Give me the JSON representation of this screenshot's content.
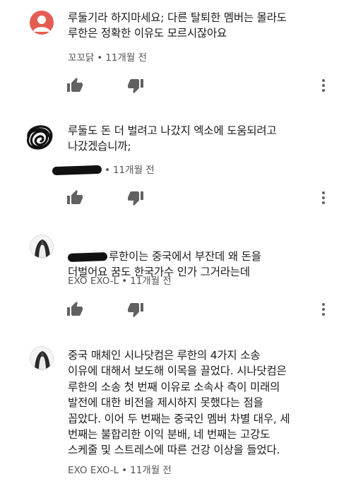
{
  "comments": [
    {
      "author": "꼬꼬닭",
      "text": "루둘기라 하지마세요; 다른 탈퇴한 멤버는 몰라도\n루한은 정확한 이유도 모르시잖아요",
      "time": "11개월 전",
      "avatar": "person-placeholder"
    },
    {
      "author": "",
      "text": "루둘도 돈 더 벌려고 나갔지 엑소에 도움되려고\n나갔겠습니까;",
      "time": "11개월 전",
      "avatar": "scribbled-out"
    },
    {
      "author": "EXO EXO-L",
      "text": "루한이는 중국에서 부잔데 왜 돈을\n더벌어요 꿈도 한국가수 인가 그거라는데",
      "time": "11개월 전",
      "avatar": "exo-photo"
    },
    {
      "author": "EXO EXO-L",
      "text": "중국 매체인 시나닷컴은 루한의 4가지 소송\n이유에 대해서 보도해 이목을 끌었다. 시나닷컴은\n루한의 소송 첫 번째 이유로 소속사 측이 미래의\n발전에 대한 비전을 제시하지 못했다는 점을\n꼽았다. 이어 두 번째는 중국인 멤버 차별 대우, 세\n번째는 불합리한 이익 분배, 네 번째는 고강도\n스케줄 및 스트레스에 따른 건강 이상을 들었다.",
      "time": "11개월 전",
      "avatar": "exo-photo"
    }
  ],
  "separator": "•",
  "icons": {
    "like": "thumbs-up-icon",
    "dislike": "thumbs-down-icon",
    "more": "more-vert-icon"
  },
  "colors": {
    "avatar_red": "#e45d53",
    "meta_text": "#555555",
    "icon": "#616161"
  }
}
